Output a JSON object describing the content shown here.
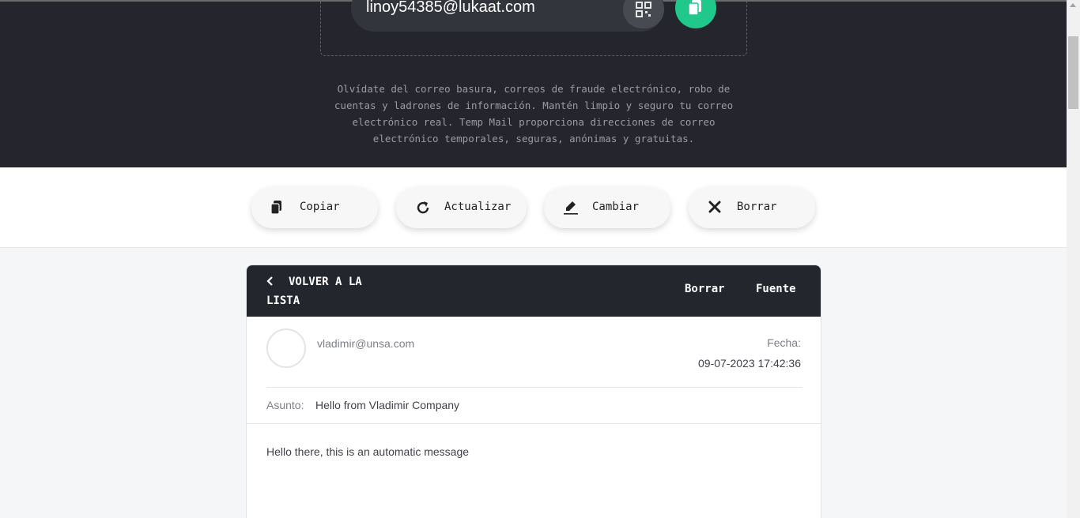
{
  "hero": {
    "email_address": "linoy54385@lukaat.com",
    "description": "Olvídate del correo basura, correos de fraude electrónico, robo de cuentas y ladrones de información. Mantén limpio y seguro tu correo electrónico real. Temp Mail proporciona direcciones de correo electrónico temporales, seguras, anónimas y gratuitas."
  },
  "toolbar": {
    "copy_label": "Copiar",
    "refresh_label": "Actualizar",
    "change_label": "Cambiar",
    "delete_label": "Borrar"
  },
  "message": {
    "back_line1": "VOLVER A LA",
    "back_line2": "LISTA",
    "delete_label": "Borrar",
    "source_label": "Fuente",
    "sender": "vladimir@unsa.com",
    "date_label": "Fecha:",
    "date_value": "09-07-2023 17:42:36",
    "subject_label": "Asunto:",
    "subject_value": "Hello from Vladimir Company",
    "body": "Hello there, this is an automatic message"
  },
  "colors": {
    "hero_bg": "#25262d",
    "accent_green": "#21c88c",
    "header_bg": "#24262d"
  }
}
